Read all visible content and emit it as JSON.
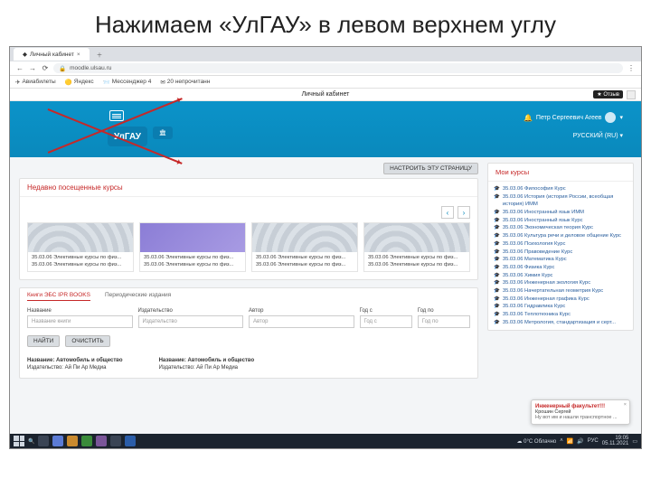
{
  "slide": {
    "title": "Нажимаем «УлГАУ» в левом верхнем углу"
  },
  "browser": {
    "tab_title": "Личный кабинет",
    "url": "moodle.ulsau.ru",
    "bookmarks": [
      "Авиабилеты",
      "Яндекс",
      "Мессенджер 4",
      "20 непрочитанн"
    ],
    "page_heading": "Личный кабинет",
    "help_button": "Отзыв"
  },
  "header": {
    "logo": "УлГАУ",
    "user_name": "Петр Сергеевич Агеев",
    "language": "РУССКИЙ (RU)"
  },
  "configure_btn": "НАСТРОИТЬ ЭТУ СТРАНИЦУ",
  "recent": {
    "title": "Недавно посещенные курсы",
    "tile_line1": "35.03.06 Элективные курсы по физ...",
    "tile_line2": "35.03.06 Элективные курсы по физ..."
  },
  "booksearch": {
    "tab1": "Книги ЭБС IPR BOOKS",
    "tab2": "Периодические издания",
    "cols": {
      "name": "Название",
      "pub": "Издательство",
      "author": "Автор",
      "yfrom": "Год с",
      "yto": "Год по"
    },
    "ph": {
      "name": "Название книги",
      "pub": "Издательство",
      "author": "Автор",
      "yfrom": "Год с",
      "yto": "Год по"
    },
    "find": "НАЙТИ",
    "clear": "ОЧИСТИТЬ",
    "result1": {
      "name": "Название: Автомобиль и общество",
      "pub": "Издательство: Ай Пи Ар Медиа"
    },
    "result2": {
      "name": "Название: Автомобиль и общество",
      "pub": "Издательство: Ай Пи Ар Медиа"
    }
  },
  "mycourses": {
    "title": "Мои курсы",
    "items": [
      "35.03.06 Философия Курс",
      "35.03.06 История (история России, всеобщая история) ИММ",
      "35.03.06 Иностранный язык ИММ",
      "35.03.06 Иностранный язык Курс",
      "35.03.06 Экономическая теория Курс",
      "35.03.06 Культура речи и деловое общение Курс",
      "35.03.06 Психология Курс",
      "35.03.06 Правоведение Курс",
      "35.03.06 Математика Курс",
      "35.03.06 Физика Курс",
      "35.03.06 Химия Курс",
      "35.03.06 Инженерная экология Курс",
      "35.03.06 Начертательная геометрия Курс",
      "35.03.06 Инженерная графика Курс",
      "35.03.06 Гидравлика Курс",
      "35.03.06 Теплотехника Курс",
      "35.03.06 Метрология, стандартизация и серт..."
    ]
  },
  "help_bubble": {
    "title": "Инженерный факультет!!!",
    "from": "Крошин Сергей",
    "msg": "Ну вот им и нашли транспортное ..."
  },
  "taskbar": {
    "weather": "0°C Облачно",
    "lang": "РУС",
    "time": "19:05",
    "date": "05.11.2021"
  }
}
